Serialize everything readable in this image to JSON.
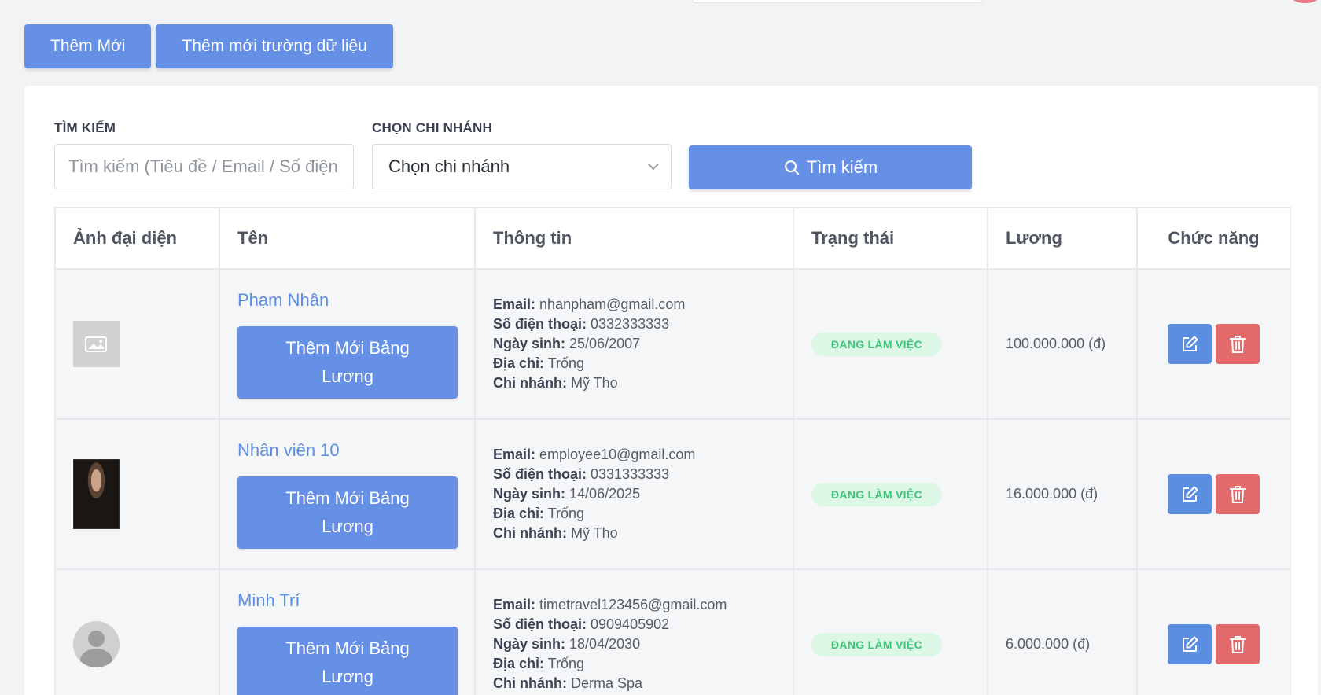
{
  "top_actions": {
    "add_new": "Thêm Mới",
    "add_field": "Thêm mới trường dữ liệu"
  },
  "filters": {
    "search_label": "TÌM KIẾM",
    "search_placeholder": "Tìm kiếm (Tiêu đề / Email / Số điện thoại)",
    "branch_label": "CHỌN CHI NHÁNH",
    "branch_value": "Chọn chi nhánh",
    "search_button": "Tìm kiếm"
  },
  "table": {
    "headers": [
      "Ảnh đại diện",
      "Tên",
      "Thông tin",
      "Trạng thái",
      "Lương",
      "Chức năng"
    ],
    "info_labels": {
      "email": "Email:",
      "phone": "Số điện thoại:",
      "birthday": "Ngày sinh:",
      "address": "Địa chỉ:",
      "branch": "Chi nhánh:"
    },
    "add_salary_button": "Thêm Mới Bảng Lương",
    "rows": [
      {
        "name": "Phạm Nhân",
        "email": "nhanpham@gmail.com",
        "phone": "0332333333",
        "birthday": "25/06/2007",
        "address": "Trống",
        "branch": "Mỹ Tho",
        "status": "ĐANG LÀM VIỆC",
        "salary": "100.000.000 (đ)",
        "avatar": "image-placeholder-icon"
      },
      {
        "name": "Nhân viên 10",
        "email": "employee10@gmail.com",
        "phone": "0331333333",
        "birthday": "14/06/2025",
        "address": "Trống",
        "branch": "Mỹ Tho",
        "status": "ĐANG LÀM VIỆC",
        "salary": "16.000.000 (đ)",
        "avatar": "person-photo"
      },
      {
        "name": "Minh Trí",
        "email": "timetravel123456@gmail.com",
        "phone": "0909405902",
        "birthday": "18/04/2030",
        "address": "Trống",
        "branch": "Derma Spa",
        "status": "ĐANG LÀM VIỆC",
        "salary": "6.000.000 (đ)",
        "avatar": "default-user-icon"
      }
    ]
  },
  "colors": {
    "primary": "#6690e6",
    "danger": "#e26a6a",
    "link": "#5b8de0",
    "status_bg": "#dcf7e6",
    "status_text": "#3fc47a"
  }
}
